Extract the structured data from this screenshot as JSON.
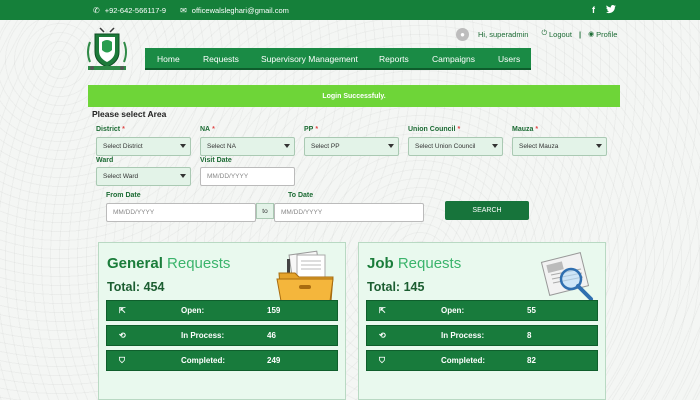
{
  "topbar": {
    "phone": "+92-642-566117-9",
    "email": "officewalsleghari@gmail.com",
    "social": [
      "f",
      "twitter-icon"
    ]
  },
  "user": {
    "greeting": "Hi, superadmin",
    "logout_label": "Logout",
    "separator": "|",
    "profile_label": "Profile"
  },
  "menu": {
    "items": [
      "Home",
      "Requests",
      "Supervisory Management",
      "Reports",
      "Campaigns",
      "Users"
    ]
  },
  "alert": {
    "message": "Login Successfuly."
  },
  "filters": {
    "section_title": "Please select Area",
    "district": {
      "label": "District",
      "required": "*",
      "value": "Select District"
    },
    "na": {
      "label": "NA",
      "required": "*",
      "value": "Select NA"
    },
    "pp": {
      "label": "PP",
      "required": "*",
      "value": "Select PP"
    },
    "union_council": {
      "label": "Union Council",
      "required": "*",
      "value": "Select Union Council"
    },
    "mauza": {
      "label": "Mauza",
      "required": "*",
      "value": "Select Mauza"
    },
    "ward": {
      "label": "Ward",
      "value": "Select Ward"
    },
    "visit_date": {
      "label": "Visit Date",
      "placeholder": "MM/DD/YYYY"
    },
    "from_date": {
      "label": "From Date",
      "placeholder": "MM/DD/YYYY"
    },
    "to_chip": "to",
    "to_date": {
      "label": "To Date",
      "placeholder": "MM/DD/YYYY"
    },
    "search_label": "SEARCH"
  },
  "cards": {
    "general": {
      "title_bold": "General",
      "title_light": " Requests",
      "total": "Total: 454",
      "rows": [
        {
          "icon": "open-icon",
          "label": "Open:",
          "value": "159"
        },
        {
          "icon": "refresh-icon",
          "label": "In Process:",
          "value": "46"
        },
        {
          "icon": "bookmark-icon",
          "label": "Completed:",
          "value": "249"
        }
      ]
    },
    "job": {
      "title_bold": "Job",
      "title_light": " Requests",
      "total": "Total: 145",
      "rows": [
        {
          "icon": "open-icon",
          "label": "Open:",
          "value": "55"
        },
        {
          "icon": "refresh-icon",
          "label": "In Process:",
          "value": "8"
        },
        {
          "icon": "bookmark-icon",
          "label": "Completed:",
          "value": "82"
        }
      ]
    }
  },
  "colors": {
    "brand_green": "#15803a",
    "menu_green": "#1a8b45",
    "alert_green": "#6ed538",
    "card_bg": "#e9f9ee"
  }
}
